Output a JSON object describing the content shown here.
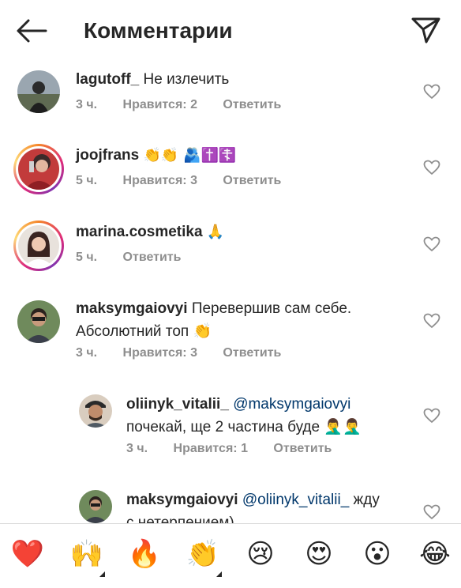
{
  "header": {
    "title": "Комментарии",
    "back_icon": "arrow-left-icon",
    "send_icon": "paper-plane-icon"
  },
  "comments": [
    {
      "username": "lagutoff_",
      "text": "Не излечить",
      "time": "3 ч.",
      "likes": "Нравится: 2",
      "reply": "Ответить",
      "has_story": false
    },
    {
      "username": "joojfrans",
      "text": "👏👏 🫂✝️☦️",
      "time": "5 ч.",
      "likes": "Нравится: 3",
      "reply": "Ответить",
      "has_story": true
    },
    {
      "username": "marina.cosmetika",
      "text": "🙏",
      "time": "5 ч.",
      "reply": "Ответить",
      "has_story": true
    },
    {
      "username": "maksymgaiovyi",
      "text_line1": "Перевершив сам себе.",
      "text_line2": "Абсолютний топ 👏",
      "time": "3 ч.",
      "likes": "Нравится: 3",
      "reply": "Ответить",
      "has_story": false
    }
  ],
  "replies": [
    {
      "username": "oliinyk_vitalii_",
      "mention": "@maksymgaiovyi",
      "text": "почекай, ще 2 частина буде 🤦‍♂️🤦‍♂️",
      "time": "3 ч.",
      "likes": "Нравится: 1",
      "reply": "Ответить"
    },
    {
      "username": "maksymgaiovyi",
      "mention": "@oliinyk_vitalii_",
      "text_line1": "жду",
      "text_line2": "с нетерпением)"
    }
  ],
  "emoji_bar": [
    "❤️",
    "🙌",
    "🔥",
    "👏",
    "😢",
    "😍",
    "😮",
    "😂"
  ],
  "colors": {
    "text": "#262626",
    "meta": "#8e8e8e",
    "mention": "#00376b",
    "heart_red": "#ed4956"
  }
}
